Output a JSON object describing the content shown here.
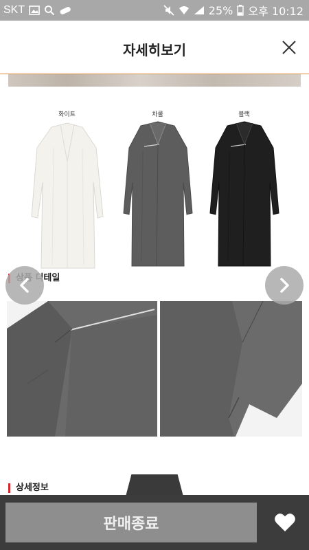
{
  "status_bar": {
    "carrier": "SKT",
    "battery": "25%",
    "time": "오후 10:12"
  },
  "header": {
    "title": "자세히보기"
  },
  "color_options": [
    {
      "label": "화이트",
      "color": "#f2f1ec"
    },
    {
      "label": "차콜",
      "color": "#5b5b5b"
    },
    {
      "label": "블랙",
      "color": "#1c1c1c"
    }
  ],
  "sections": {
    "detail_title": "상품 디테일",
    "info_title": "상세정보"
  },
  "bottom_bar": {
    "soldout_label": "판매종료"
  },
  "colors": {
    "status_bar": "#a8a8a8",
    "header_line": "#e08a3c",
    "section_marker": "#d4272c",
    "bottom_bar": "#3c3c3c",
    "button": "#8e8e8e"
  }
}
